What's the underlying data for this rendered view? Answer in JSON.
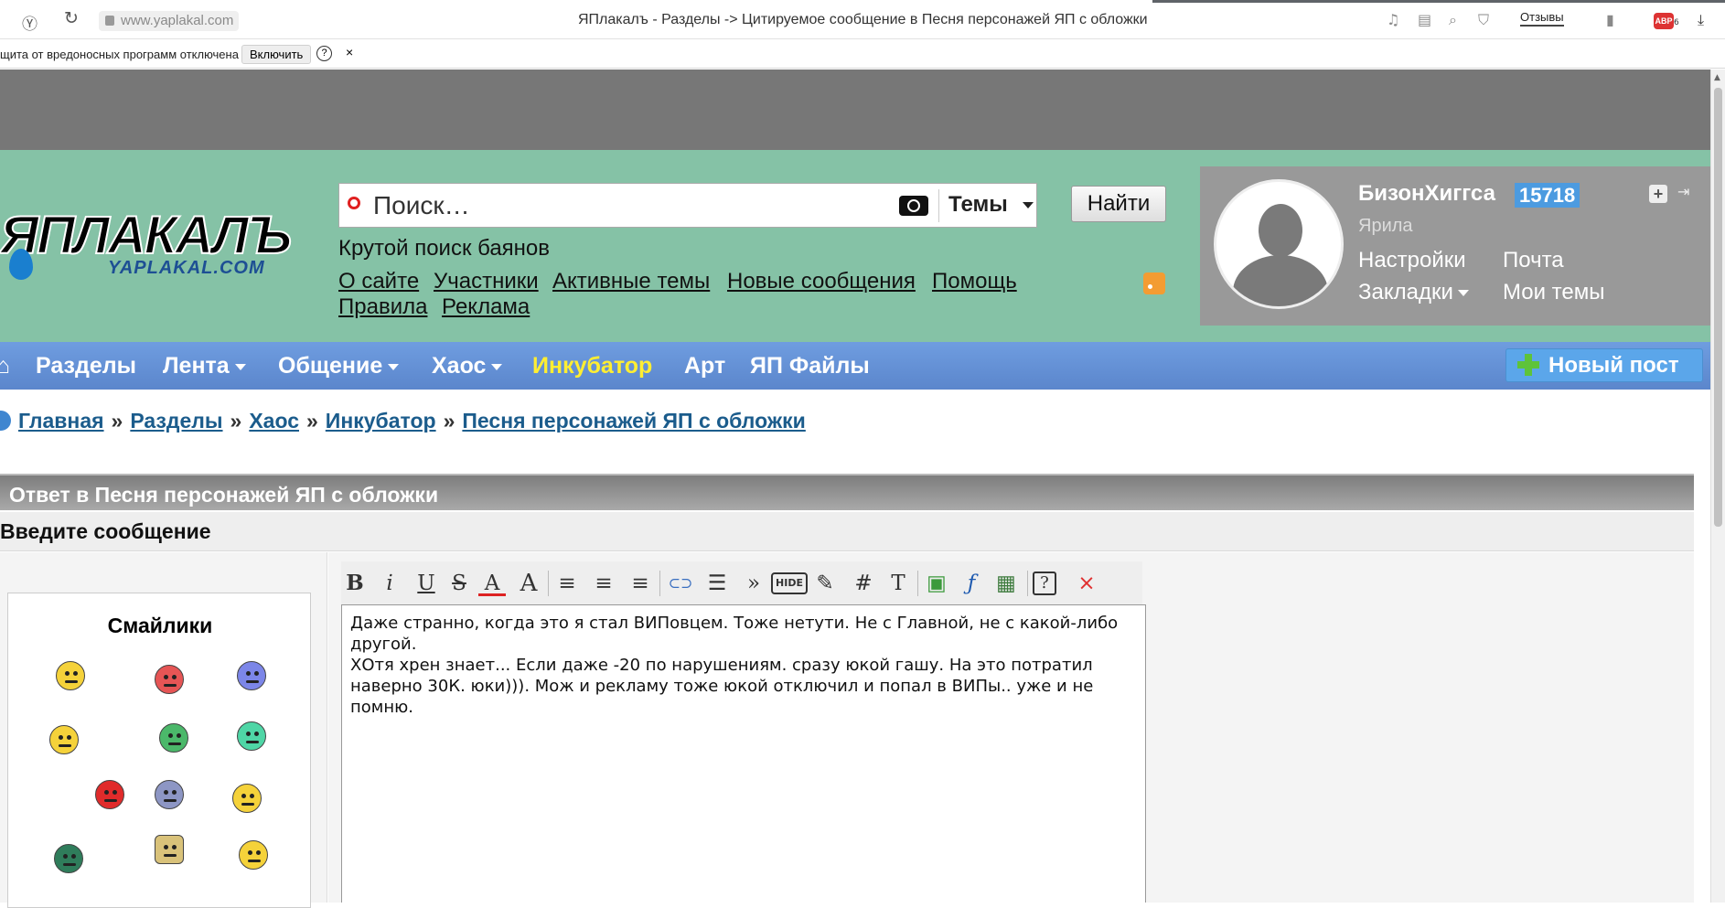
{
  "browser": {
    "url": "www.yaplakal.com",
    "title": "ЯПлакалъ - Разделы -> Цитируемое сообщение в Песня персонажей ЯП с обложки",
    "reviews_label": "Отзывы",
    "abp_label": "ABP",
    "abp_count": "6"
  },
  "notice": {
    "text": "щита от вредоносных программ отключена",
    "enable_label": "Включить",
    "help_label": "?",
    "close_label": "×"
  },
  "logo": {
    "main": "ЯПЛАКАЛЪ",
    "sub": "YAPLAKAL.COM"
  },
  "search": {
    "placeholder": "Поиск…",
    "scope_label": "Темы",
    "find_label": "Найти"
  },
  "slogan": "Крутой поиск баянов",
  "site_nav": [
    {
      "label": "О сайте"
    },
    {
      "label": "Участники"
    },
    {
      "label": "Активные темы"
    },
    {
      "label": "Новые сообщения"
    },
    {
      "label": "Помощь"
    },
    {
      "label": "Правила"
    },
    {
      "label": "Реклама"
    }
  ],
  "user": {
    "name": "БизонХиггса",
    "karma": "15718",
    "title": "Ярила",
    "settings_label": "Настройки",
    "mail_label": "Почта",
    "bookmarks_label": "Закладки",
    "my_topics_label": "Мои темы",
    "plus_label": "+"
  },
  "menu": {
    "items": [
      {
        "label": "Разделы"
      },
      {
        "label": "Лента"
      },
      {
        "label": "Общение"
      },
      {
        "label": "Хаос"
      },
      {
        "label": "Инкубатор"
      },
      {
        "label": "Арт"
      },
      {
        "label": "ЯП Файлы"
      }
    ],
    "new_post_label": "Новый пост",
    "highlight_color": "#ffee32"
  },
  "breadcrumb": {
    "items": [
      "Главная",
      "Разделы",
      "Хаос",
      "Инкубатор",
      "Песня персонажей ЯП с обложки"
    ],
    "separator": "»"
  },
  "reply": {
    "header": "Ответ в Песня персонажей ЯП с обложки",
    "enter_label": "Введите сообщение"
  },
  "smilies": {
    "title": "Смайлики"
  },
  "toolbar": {
    "bold": "B",
    "italic": "i",
    "underline": "U",
    "strike": "S",
    "color": "A",
    "size": "A",
    "align_left": "≡",
    "align_center": "≡",
    "align_right": "≡",
    "link": "⊂⊃",
    "list": "☰",
    "quote": "»",
    "hide": "HIDE",
    "edit": "✎",
    "hash": "#",
    "text": "T",
    "image": "▣",
    "flash": "ƒ",
    "video": "▦",
    "help": "?",
    "close": "×"
  },
  "editor": {
    "text": "Даже странно, когда это я стал ВИПовцем. Тоже нетути. Не с Главной, не с какой-либо другой.\nХОтя хрен знает... Если даже -20 по нарушениям. сразу юкой гашу. На это потратил наверно 30К. юки))). Мож и рекламу тоже юкой отключил и попал в ВИПы.. уже и не помню."
  }
}
